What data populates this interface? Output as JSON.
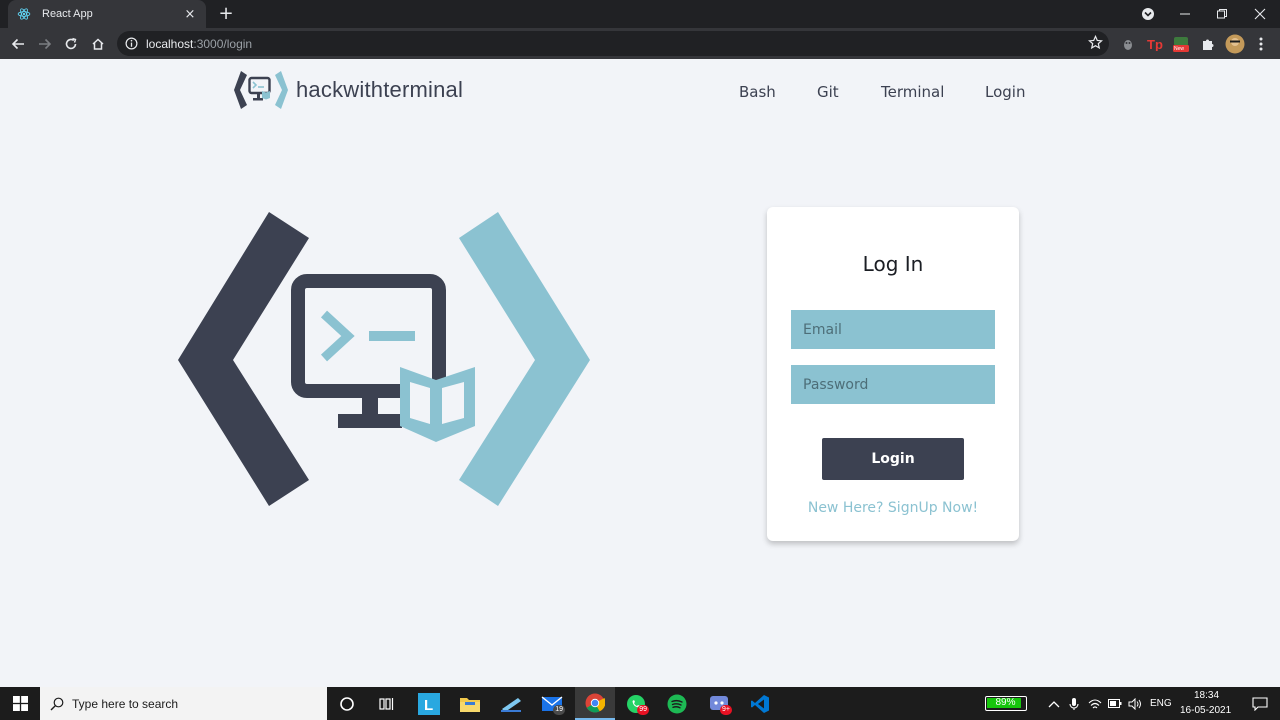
{
  "browser": {
    "tab_title": "React App",
    "tab_close": "×",
    "new_tab": "+",
    "url_host": "localhost",
    "url_path": ":3000/login",
    "ext_badge": "New"
  },
  "site": {
    "brand": "hackwithterminal",
    "nav": [
      {
        "label": "Bash"
      },
      {
        "label": "Git"
      },
      {
        "label": "Terminal"
      },
      {
        "label": "Login"
      }
    ]
  },
  "login_card": {
    "title": "Log In",
    "email_placeholder": "Email",
    "password_placeholder": "Password",
    "submit_label": "Login",
    "signup_text": "New Here?  SignUp Now!"
  },
  "taskbar": {
    "search_placeholder": "Type here to search",
    "mail_badge": "19",
    "whatsapp_badge": "99",
    "discord_badge": "9+",
    "battery": "89%",
    "language": "ENG",
    "time": "18:34",
    "date": "16-05-2021"
  },
  "colors": {
    "primary_dark": "#3c4151",
    "accent_blue": "#8bc2d1",
    "page_bg": "#f2f4f8"
  }
}
